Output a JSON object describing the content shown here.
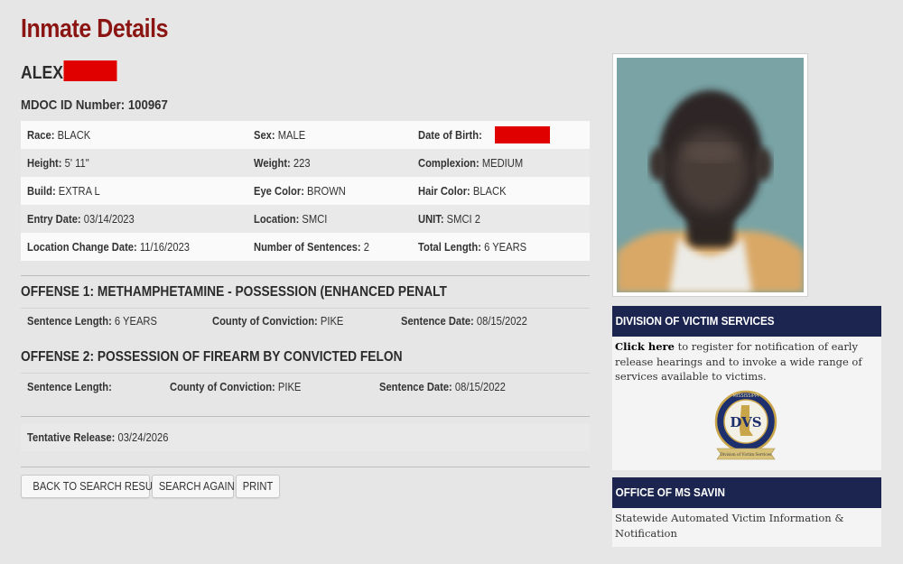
{
  "page": {
    "title": "Inmate Details"
  },
  "inmate": {
    "first_name": "ALEX",
    "mdoc_label": "MDOC ID Number:",
    "mdoc_id": "100967"
  },
  "details": {
    "race_label": "Race:",
    "race": "BLACK",
    "sex_label": "Sex:",
    "sex": "MALE",
    "dob_label": "Date of Birth:",
    "height_label": "Height:",
    "height": "5' 11\"",
    "weight_label": "Weight:",
    "weight": "223",
    "complexion_label": "Complexion:",
    "complexion": "MEDIUM",
    "build_label": "Build:",
    "build": "EXTRA L",
    "eye_label": "Eye Color:",
    "eye": "BROWN",
    "hair_label": "Hair Color:",
    "hair": "BLACK",
    "entry_label": "Entry Date:",
    "entry": "03/14/2023",
    "location_label": "Location:",
    "location": "SMCI",
    "unit_label": "UNIT:",
    "unit": "SMCI 2",
    "loc_change_label": "Location Change Date:",
    "loc_change": "11/16/2023",
    "num_sent_label": "Number of Sentences:",
    "num_sent": "2",
    "total_len_label": "Total Length:",
    "total_len": "6 YEARS"
  },
  "offenses": [
    {
      "title": "OFFENSE 1: METHAMPHETAMINE - POSSESSION (ENHANCED PENALT",
      "sentence_length_label": "Sentence Length:",
      "sentence_length": "6 YEARS",
      "county_label": "County of Conviction:",
      "county": "PIKE",
      "sentence_date_label": "Sentence Date:",
      "sentence_date": "08/15/2022"
    },
    {
      "title": "OFFENSE 2: POSSESSION OF FIREARM BY CONVICTED FELON",
      "sentence_length_label": "Sentence Length:",
      "sentence_length": "",
      "county_label": "County of Conviction:",
      "county": "PIKE",
      "sentence_date_label": "Sentence Date:",
      "sentence_date": "08/15/2022"
    }
  ],
  "release": {
    "label": "Tentative Release:",
    "date": "03/24/2026"
  },
  "buttons": {
    "back": "BACK TO SEARCH RESULTS",
    "search": "SEARCH AGAIN",
    "print": "PRINT"
  },
  "victim_services": {
    "heading": "DIVISION OF VICTIM SERVICES",
    "link": "Click here",
    "text": " to register for notification of early release hearings and to invoke a wide range of services available to victims.",
    "seal_text_top": "MISSISSIPPI",
    "seal_letters": "DVS",
    "seal_banner": "Division of Victim Services"
  },
  "savin": {
    "heading": "OFFICE OF MS SAVIN",
    "text": "Statewide Automated Victim Information & Notification"
  },
  "colors": {
    "title": "#8b1512",
    "panel_header": "#1b2550",
    "redaction": "#e00000"
  }
}
